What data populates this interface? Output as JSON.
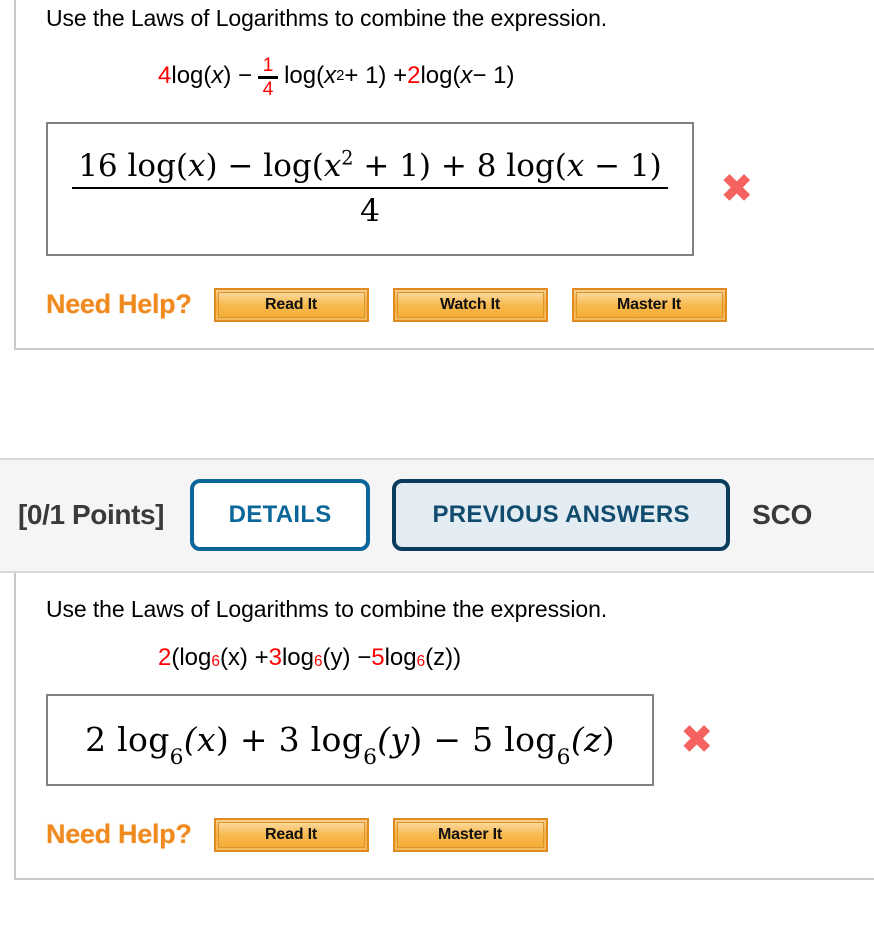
{
  "problems": [
    {
      "prompt": "Use the Laws of Logarithms to combine the expression.",
      "given": {
        "coef1": "4",
        "log1": " log(",
        "var1": "x",
        "close1": ") − ",
        "frac_num": "1",
        "frac_den": "4",
        "log2": " log(",
        "var2": "x",
        "exp2": "2",
        "plus2": " + 1) + ",
        "coef3": "2",
        "log3": " log(",
        "var3": "x",
        "close3": " − 1)"
      },
      "answer": {
        "numerator_parts": {
          "c1": "16 log(",
          "v1": "x",
          "s1": ") − log(",
          "v2": "x",
          "e2": "2",
          "s2": " + 1) + 8 log(",
          "v3": "x",
          "s3": " − 1)"
        },
        "denominator": "4",
        "plain_text": "(16 log(x) − log(x² + 1) + 8 log(x − 1)) / 4",
        "status_icon": "x-mark-icon",
        "status_color": "#f4635f"
      },
      "need_help": {
        "label": "Need Help?",
        "buttons": [
          "Read It",
          "Watch It",
          "Master It"
        ]
      }
    },
    {
      "points": "[0/1 Points]",
      "details_label": "DETAILS",
      "previous_answers_label": "PREVIOUS ANSWERS",
      "score_label": "SCO",
      "prompt": "Use the Laws of Logarithms to combine the expression.",
      "given": {
        "coef1": "2",
        "open": "(log",
        "base1": "6",
        "arg1": "(x) + ",
        "coef2": "3",
        "log2": " log",
        "base2": "6",
        "arg2": "(y) − ",
        "coef3": "5",
        "log3": " log",
        "base3": "6",
        "arg3": "(z))"
      },
      "answer": {
        "parts": {
          "a1": "2 log",
          "b1": "6",
          "v1": "(x",
          "s1": ") + 3 log",
          "b2": "6",
          "v2": "(y",
          "s2": ") − 5 log",
          "b3": "6",
          "v3": "(z",
          "s3": ")"
        },
        "plain_text": "2 log₆(x) + 3 log₆(y) − 5 log₆(z)",
        "status_icon": "x-mark-icon",
        "status_color": "#f4635f"
      },
      "need_help": {
        "label": "Need Help?",
        "buttons": [
          "Read It",
          "Master It"
        ]
      }
    }
  ],
  "icons": {
    "x_mark": "✖"
  },
  "colors": {
    "red_coefficient": "#ff0000",
    "need_help_orange": "#f08a1e",
    "details_blue": "#0b6699",
    "previous_navy": "#0a3d5c",
    "incorrect_red": "#f4635f"
  }
}
